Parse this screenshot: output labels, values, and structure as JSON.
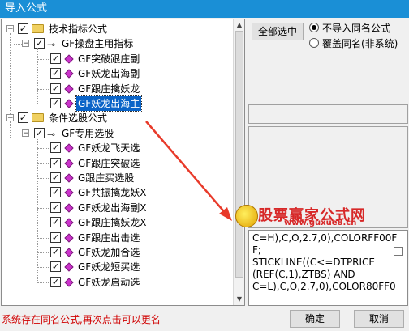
{
  "window": {
    "title": "导入公式"
  },
  "tree": {
    "groups": [
      {
        "label": "技术指标公式",
        "checked": true,
        "subgroup": {
          "label": "GF操盘主用指标",
          "checked": true,
          "items": [
            {
              "label": "GF突破跟庄副",
              "checked": true,
              "selected": false
            },
            {
              "label": "GF妖龙出海副",
              "checked": true,
              "selected": false
            },
            {
              "label": "GF跟庄擒妖龙",
              "checked": true,
              "selected": false
            },
            {
              "label": "GF妖龙出海主",
              "checked": true,
              "selected": true
            }
          ]
        }
      },
      {
        "label": "条件选股公式",
        "checked": true,
        "subgroup": {
          "label": "GF专用选股",
          "checked": true,
          "items": [
            {
              "label": "GF妖龙飞天选",
              "checked": true
            },
            {
              "label": "GF跟庄突破选",
              "checked": true
            },
            {
              "label": "G跟庄买选股",
              "checked": true
            },
            {
              "label": "GF共振擒龙妖X",
              "checked": true
            },
            {
              "label": "GF妖龙出海副X",
              "checked": true
            },
            {
              "label": "GF跟庄擒妖龙X",
              "checked": true
            },
            {
              "label": "GF跟庄出击选",
              "checked": true
            },
            {
              "label": "GF妖龙加合选",
              "checked": true
            },
            {
              "label": "GF妖龙短买选",
              "checked": true
            },
            {
              "label": "GF妖龙启动选",
              "checked": true
            }
          ]
        }
      }
    ]
  },
  "controls": {
    "select_all_label": "全部选中",
    "option_skip_label": "不导入同名公式",
    "option_overwrite_label": "覆盖同名(非系统)",
    "selected_option": "skip"
  },
  "watermark": {
    "title": "股票赢家公式网",
    "url": "www.guxue8.cn"
  },
  "code_lines": [
    "C=H),C,O,2.7,0),COLORFF00F",
    "F;",
    "STICKLINE((C<=DTPRICE",
    "(REF(C,1),ZTBS) AND",
    "C=L),C,O,2.7,0),COLOR80FF0"
  ],
  "status": {
    "message": "系统存在同名公式,再次点击可以更名"
  },
  "buttons": {
    "ok_label": "确定",
    "cancel_label": "取消"
  },
  "colors": {
    "titlebar": "#1a8fd6",
    "selection": "#0a64c8",
    "status_text": "#d00000",
    "arrow": "#e83a2a"
  }
}
